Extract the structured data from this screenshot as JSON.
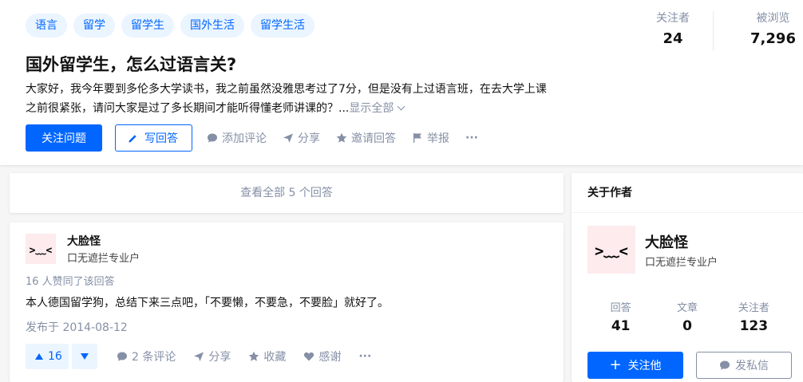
{
  "question": {
    "topics": [
      "语言",
      "留学",
      "留学生",
      "国外生活",
      "留学生活"
    ],
    "title": "国外留学生，怎么过语言关?",
    "detail": "大家好，我今年要到多伦多大学读书，我之前虽然没雅思考过了7分，但是没有上过语言班，在去大学上课之前很紧张，请问大家是过了多长期间才能听得懂老师讲课的？...",
    "show_all": "显示全部",
    "follow_label": "关注问题",
    "write_label": "写回答",
    "comment_label": "添加评论",
    "share_label": "分享",
    "invite_label": "邀请回答",
    "report_label": "举报",
    "more": "···"
  },
  "stats": {
    "followers_label": "关注者",
    "followers_value": "24",
    "views_label": "被浏览",
    "views_value": "7,296"
  },
  "view_all": "查看全部 5 个回答",
  "answer": {
    "avatar_text": ">﹏<",
    "author_name": "大脸怪",
    "author_bio": "口无遮拦专业户",
    "votes_text": "16 人赞同了该回答",
    "content": "本人德国留学狗，总结下来三点吧，「不要懒，不要急，不要脸」就好了。",
    "published": "发布于 2014-08-12",
    "vote_count": "16",
    "comments_label": "2 条评论",
    "share_label": "分享",
    "collect_label": "收藏",
    "thanks_label": "感谢",
    "more": "···"
  },
  "sidebar": {
    "title": "关于作者",
    "avatar_text": ">﹏<",
    "author_name": "大脸怪",
    "author_bio": "口无遮拦专业户",
    "answers_label": "回答",
    "answers_value": "41",
    "articles_label": "文章",
    "articles_value": "0",
    "followers_label": "关注者",
    "followers_value": "123",
    "follow_label": "关注他",
    "message_label": "发私信"
  },
  "colors": {
    "brand": "#0066ff",
    "muted": "#8590a6",
    "tag_bg": "#ebf5ff",
    "avatar_bg": "#fdebed"
  }
}
